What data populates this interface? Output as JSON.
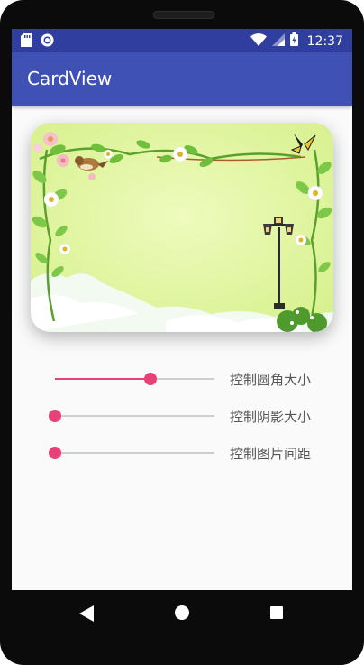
{
  "status_bar": {
    "time": "12:37",
    "left_icons": [
      "sd-card-icon",
      "sync-icon"
    ],
    "right_icons": [
      "wifi-icon",
      "signal-icon",
      "battery-icon"
    ]
  },
  "app_bar": {
    "title": "CardView"
  },
  "card": {
    "image": "spring-flower-frame-illustration"
  },
  "sliders": [
    {
      "label": "控制圆角大小",
      "value": 0.6
    },
    {
      "label": "控制阴影大小",
      "value": 0.0
    },
    {
      "label": "控制图片间距",
      "value": 0.0
    }
  ],
  "colors": {
    "status_bar": "#303f9f",
    "app_bar": "#3f51b5",
    "accent": "#e94077",
    "track": "#cfcfcf"
  },
  "nav_bar": [
    "back-icon",
    "home-icon",
    "recents-icon"
  ]
}
